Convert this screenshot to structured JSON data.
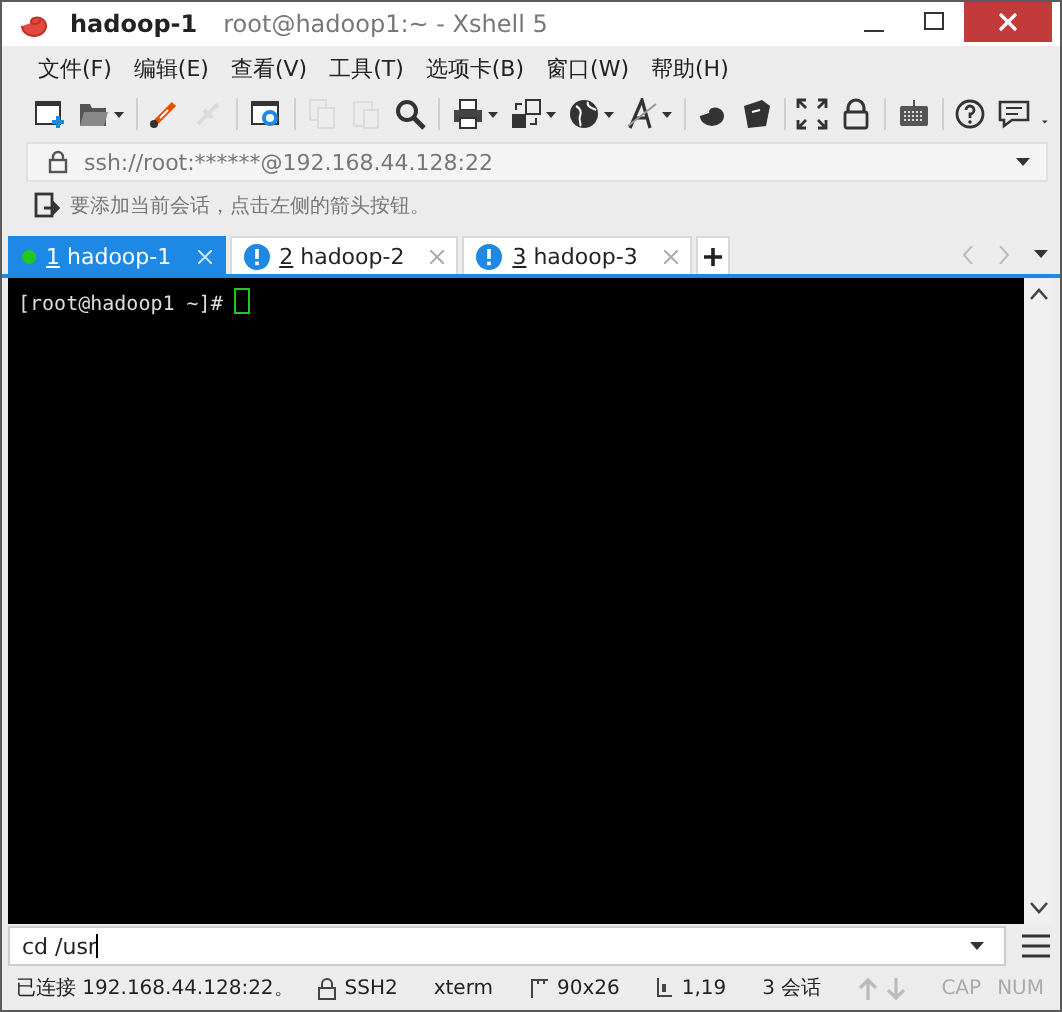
{
  "window": {
    "session": "hadoop-1",
    "title": "root@hadoop1:~ - Xshell 5"
  },
  "menu": [
    "文件(F)",
    "编辑(E)",
    "查看(V)",
    "工具(T)",
    "选项卡(B)",
    "窗口(W)",
    "帮助(H)"
  ],
  "toolbar": [
    {
      "kind": "new",
      "disabled": false,
      "dropdown": false
    },
    {
      "kind": "folder",
      "disabled": false,
      "dropdown": true
    },
    {
      "kind": "separator"
    },
    {
      "kind": "connect",
      "disabled": false,
      "dropdown": false
    },
    {
      "kind": "plug",
      "disabled": true,
      "dropdown": false
    },
    {
      "kind": "separator"
    },
    {
      "kind": "properties",
      "disabled": false,
      "dropdown": false
    },
    {
      "kind": "separator"
    },
    {
      "kind": "copy",
      "disabled": true,
      "dropdown": false
    },
    {
      "kind": "paste",
      "disabled": true,
      "dropdown": false
    },
    {
      "kind": "search",
      "disabled": false,
      "dropdown": false
    },
    {
      "kind": "separator"
    },
    {
      "kind": "print",
      "disabled": false,
      "dropdown": true
    },
    {
      "kind": "transfer",
      "disabled": false,
      "dropdown": true
    },
    {
      "kind": "globe",
      "disabled": false,
      "dropdown": true
    },
    {
      "kind": "font",
      "disabled": false,
      "dropdown": true
    },
    {
      "kind": "separator"
    },
    {
      "kind": "shell",
      "disabled": false,
      "dropdown": false
    },
    {
      "kind": "script",
      "disabled": false,
      "dropdown": false
    },
    {
      "kind": "separator"
    },
    {
      "kind": "fullscreen",
      "disabled": false,
      "dropdown": false
    },
    {
      "kind": "lock",
      "disabled": false,
      "dropdown": false
    },
    {
      "kind": "separator"
    },
    {
      "kind": "keyboard",
      "disabled": false,
      "dropdown": false
    },
    {
      "kind": "separator"
    },
    {
      "kind": "help",
      "disabled": false,
      "dropdown": false
    },
    {
      "kind": "chat",
      "disabled": false,
      "dropdown": false
    }
  ],
  "address": {
    "value": "ssh://root:******@192.168.44.128:22"
  },
  "hint": "要添加当前会话，点击左侧的箭头按钮。",
  "tabs": [
    {
      "number": "1",
      "label": " hadoop-1",
      "selected": true,
      "connected": true
    },
    {
      "number": "2",
      "label": " hadoop-2",
      "selected": false,
      "connected": false
    },
    {
      "number": "3",
      "label": " hadoop-3",
      "selected": false,
      "connected": false
    }
  ],
  "terminal": {
    "prompt": "[root@hadoop1 ~]# "
  },
  "command_input": {
    "value": "cd /usr"
  },
  "status_bar": {
    "message": "已连接 192.168.44.128:22。",
    "protocol": "SSH2",
    "terminal_type": "xterm",
    "size": "90x26",
    "cursor": "1,19",
    "sessions": "3 会话",
    "indicators": [
      {
        "label": "CAP",
        "on": false
      },
      {
        "label": "NUM",
        "on": false
      }
    ]
  }
}
